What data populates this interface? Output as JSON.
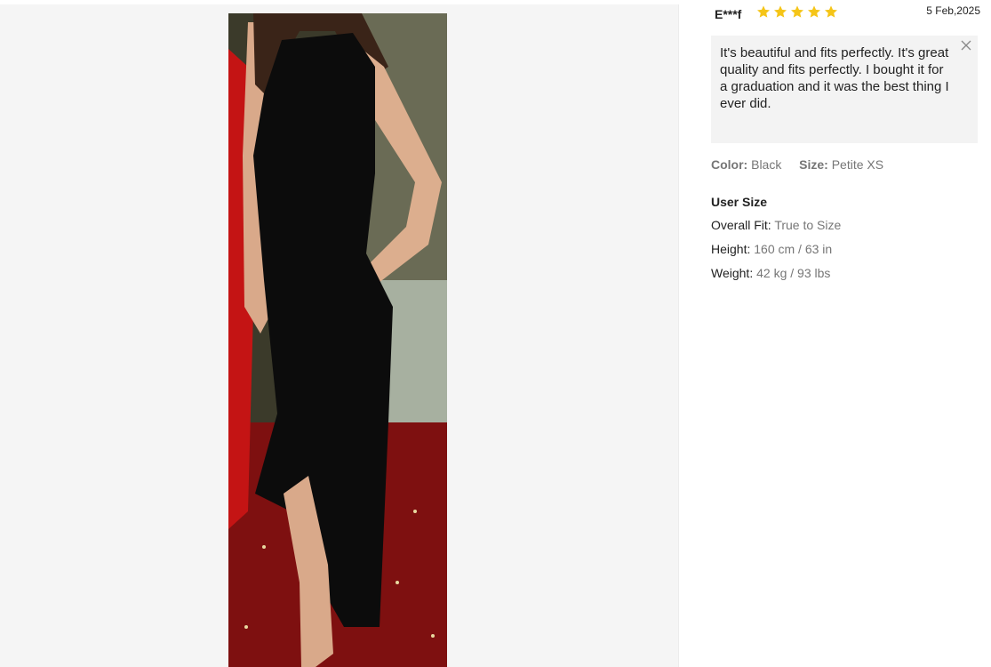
{
  "review": {
    "reviewer": "E***f",
    "rating": 5,
    "rating_max": 5,
    "date": "5 Feb,2025",
    "text": "It's beautiful and fits perfectly. It's great quality and fits perfectly. I bought it for a graduation and it was the best thing I ever did.",
    "star_color": "#f5c518"
  },
  "attributes": {
    "color_label": "Color:",
    "color_value": "Black",
    "size_label": "Size:",
    "size_value": "Petite XS"
  },
  "user_size": {
    "title": "User Size",
    "rows": [
      {
        "label": "Overall Fit:",
        "value": "True to Size"
      },
      {
        "label": "Height:",
        "value": "160 cm / 63 in"
      },
      {
        "label": "Weight:",
        "value": "42 kg / 93 lbs"
      }
    ]
  },
  "icons": {
    "close": "close-icon",
    "star": "star-icon"
  }
}
